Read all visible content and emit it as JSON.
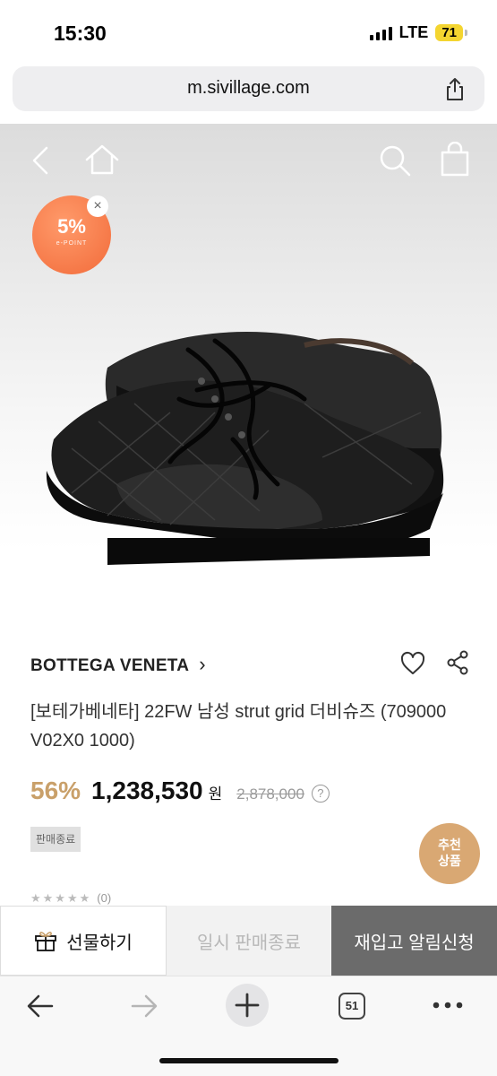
{
  "status": {
    "time": "15:30",
    "network": "LTE",
    "battery": "71"
  },
  "browser": {
    "url": "m.sivillage.com",
    "tab_count": "51"
  },
  "promo": {
    "percent": "5%",
    "subtitle": "e-POINT"
  },
  "product": {
    "brand": "BOTTEGA VENETA",
    "brand_chevron": "›",
    "name": "[보테가베네타] 22FW 남성 strut grid 더비슈즈 (709000 V02X0 1000)",
    "discount": "56%",
    "price": "1,238,530",
    "currency": "원",
    "original_price": "2,878,000",
    "info_glyph": "?",
    "status_badge": "판매종료",
    "rating_stars": "★★★★★",
    "rating_count": "(0)"
  },
  "recommend": {
    "label_line1": "추천",
    "label_line2": "상품"
  },
  "actions": {
    "gift_label": "선물하기",
    "temp_soldout_label": "일시 판매종료",
    "restock_label": "재입고 알림신청"
  },
  "icons": {
    "back": "chevron-left-icon",
    "home": "home-icon",
    "search": "search-icon",
    "bag": "shopping-bag-icon",
    "heart": "heart-icon",
    "share": "share-icon",
    "gift": "gift-icon"
  },
  "colors": {
    "discount": "#c9a06a",
    "promo": "#f26b3a",
    "recommend": "#d9a873",
    "restock_bg": "#6b6b6b"
  }
}
